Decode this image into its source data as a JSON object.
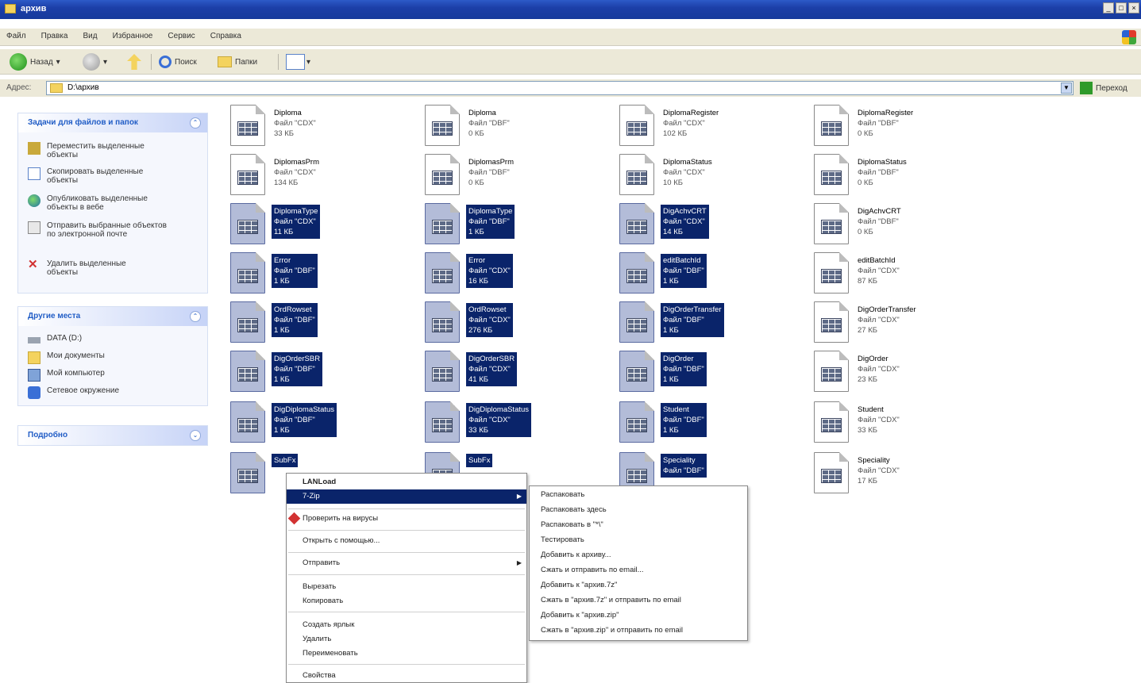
{
  "window": {
    "title": "архив"
  },
  "menubar": {
    "items": [
      "Файл",
      "Правка",
      "Вид",
      "Избранное",
      "Сервис",
      "Справка"
    ]
  },
  "toolbar": {
    "back": "Назад",
    "search": "Поиск",
    "folders": "Папки"
  },
  "address": {
    "label": "Адрес:",
    "path": "D:\\архив",
    "go": "Переход"
  },
  "tasks_pane": {
    "title": "Задачи для файлов и папок",
    "items": [
      {
        "label": "Переместить выделенные объекты",
        "icon": "move-icon"
      },
      {
        "label": "Скопировать выделенные объекты",
        "icon": "copy-icon"
      },
      {
        "label": "Опубликовать выделенные объекты в вебе",
        "icon": "globe-icon"
      },
      {
        "label": "Отправить выбранные объектов по электронной почте",
        "icon": "mail-icon"
      },
      {
        "label": "Удалить выделенные объекты",
        "icon": "delete-icon"
      }
    ]
  },
  "places_pane": {
    "title": "Другие места",
    "items": [
      {
        "label": "DATA (D:)",
        "icon": "drive-icon"
      },
      {
        "label": "Мои документы",
        "icon": "my-documents-icon"
      },
      {
        "label": "Мой компьютер",
        "icon": "my-computer-icon"
      },
      {
        "label": "Сетевое окружение",
        "icon": "network-icon"
      }
    ]
  },
  "details_pane": {
    "title": "Подробно"
  },
  "files": [
    {
      "name": "Diploma",
      "type": "Файл \"CDX\"",
      "size": "33 КБ",
      "selected": false
    },
    {
      "name": "Diploma",
      "type": "Файл \"DBF\"",
      "size": "0 КБ",
      "selected": false
    },
    {
      "name": "DiplomaRegister",
      "type": "Файл \"CDX\"",
      "size": "102 КБ",
      "selected": false
    },
    {
      "name": "DiplomaRegister",
      "type": "Файл \"DBF\"",
      "size": "0 КБ",
      "selected": false
    },
    {
      "name": "DiplomasPrm",
      "type": "Файл \"CDX\"",
      "size": "134 КБ",
      "selected": false
    },
    {
      "name": "DiplomasPrm",
      "type": "Файл \"DBF\"",
      "size": "0 КБ",
      "selected": false
    },
    {
      "name": "DiplomaStatus",
      "type": "Файл \"CDX\"",
      "size": "10 КБ",
      "selected": false
    },
    {
      "name": "DiplomaStatus",
      "type": "Файл \"DBF\"",
      "size": "0 КБ",
      "selected": false
    },
    {
      "name": "DiplomaType",
      "type": "Файл \"CDX\"",
      "size": "11 КБ",
      "selected": true
    },
    {
      "name": "DiplomaType",
      "type": "Файл \"DBF\"",
      "size": "1 КБ",
      "selected": true
    },
    {
      "name": "DigAchvCRT",
      "type": "Файл \"CDX\"",
      "size": "14 КБ",
      "selected": true
    },
    {
      "name": "DigAchvCRT",
      "type": "Файл \"DBF\"",
      "size": "0 КБ",
      "selected": false
    },
    {
      "name": "Error",
      "type": "Файл \"DBF\"",
      "size": "1 КБ",
      "selected": true
    },
    {
      "name": "Error",
      "type": "Файл \"CDX\"",
      "size": "16 КБ",
      "selected": true
    },
    {
      "name": "editBatchId",
      "type": "Файл \"DBF\"",
      "size": "1 КБ",
      "selected": true
    },
    {
      "name": "editBatchId",
      "type": "Файл \"CDX\"",
      "size": "87 КБ",
      "selected": false
    },
    {
      "name": "OrdRowset",
      "type": "Файл \"DBF\"",
      "size": "1 КБ",
      "selected": true
    },
    {
      "name": "OrdRowset",
      "type": "Файл \"CDX\"",
      "size": "276 КБ",
      "selected": true
    },
    {
      "name": "DigOrderTransfer",
      "type": "Файл \"DBF\"",
      "size": "1 КБ",
      "selected": true
    },
    {
      "name": "DigOrderTransfer",
      "type": "Файл \"CDX\"",
      "size": "27 КБ",
      "selected": false
    },
    {
      "name": "DigOrderSBR",
      "type": "Файл \"DBF\"",
      "size": "1 КБ",
      "selected": true
    },
    {
      "name": "DigOrderSBR",
      "type": "Файл \"CDX\"",
      "size": "41 КБ",
      "selected": true
    },
    {
      "name": "DigOrder",
      "type": "Файл \"DBF\"",
      "size": "1 КБ",
      "selected": true
    },
    {
      "name": "DigOrder",
      "type": "Файл \"CDX\"",
      "size": "23 КБ",
      "selected": false
    },
    {
      "name": "DigDiplomaStatus",
      "type": "Файл \"DBF\"",
      "size": "1 КБ",
      "selected": true
    },
    {
      "name": "DigDiplomaStatus",
      "type": "Файл \"CDX\"",
      "size": "33 КБ",
      "selected": true
    },
    {
      "name": "Student",
      "type": "Файл \"DBF\"",
      "size": "1 КБ",
      "selected": true
    },
    {
      "name": "Student",
      "type": "Файл \"CDX\"",
      "size": "33 КБ",
      "selected": false
    },
    {
      "name": "SubFx",
      "type": "",
      "size": "",
      "selected": true
    },
    {
      "name": "SubFx",
      "type": "",
      "size": "",
      "selected": true
    },
    {
      "name": "Speciality",
      "type": "Файл \"DBF\"",
      "size": "",
      "selected": true
    },
    {
      "name": "Speciality",
      "type": "Файл \"CDX\"",
      "size": "17 КБ",
      "selected": false
    }
  ],
  "context_menu": {
    "items": [
      {
        "label": "LANLoad",
        "bold": true
      },
      {
        "label": "7-Zip",
        "highlighted": true,
        "submenu": true
      },
      {
        "sep": true
      },
      {
        "label": "Проверить на вирусы",
        "antivirus": true
      },
      {
        "sep": true
      },
      {
        "label": "Открыть с помощью..."
      },
      {
        "sep": true
      },
      {
        "label": "Отправить",
        "submenu": true
      },
      {
        "sep": true
      },
      {
        "label": "Вырезать"
      },
      {
        "label": "Копировать"
      },
      {
        "sep": true
      },
      {
        "label": "Создать ярлык"
      },
      {
        "label": "Удалить"
      },
      {
        "label": "Переименовать"
      },
      {
        "sep": true
      },
      {
        "label": "Свойства"
      }
    ]
  },
  "submenu_7zip": {
    "items": [
      "Распаковать",
      "Распаковать здесь",
      "Распаковать в \"*\\\"",
      "Тестировать",
      "Добавить к архиву...",
      "Сжать и отправить по email...",
      "Добавить к \"архив.7z\"",
      "Сжать в \"архив.7z\" и отправить по email",
      "Добавить к \"архив.zip\"",
      "Сжать в \"архив.zip\" и отправить по email"
    ]
  }
}
